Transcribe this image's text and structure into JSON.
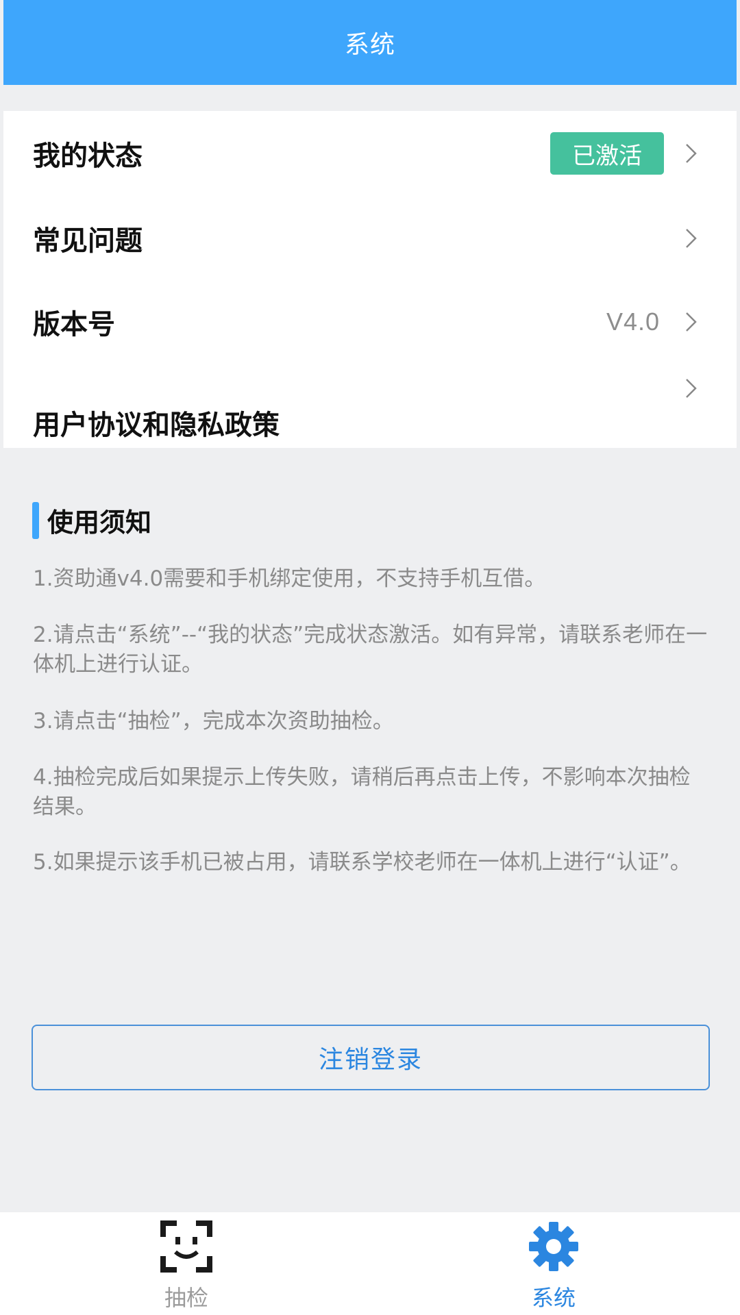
{
  "header": {
    "title": "系统"
  },
  "menu": {
    "status": {
      "label": "我的状态",
      "badge": "已激活"
    },
    "faq": {
      "label": "常见问题"
    },
    "version": {
      "label": "版本号",
      "value": "V4.0"
    },
    "agreement": {
      "label": "用户协议和隐私政策"
    }
  },
  "notice": {
    "title": "使用须知",
    "items": [
      "1.资助通v4.0需要和手机绑定使用，不支持手机互借。",
      "2.请点击“系统”--“我的状态”完成状态激活。如有异常，请联系老师在一体机上进行认证。",
      "3.请点击“抽检”，完成本次资助抽检。",
      "4.抽检完成后如果提示上传失败，请稍后再点击上传，不影响本次抽检结果。",
      "5.如果提示该手机已被占用，请联系学校老师在一体机上进行“认证”。"
    ]
  },
  "logout_label": "注销登录",
  "tabbar": {
    "tabs": [
      {
        "label": "抽检",
        "icon": "face-scan-icon",
        "active": false
      },
      {
        "label": "系统",
        "icon": "gear-icon",
        "active": true
      }
    ]
  },
  "colors": {
    "primary": "#3ea6fc",
    "badge": "#45c19d",
    "active_tab": "#2b86e0",
    "inactive_tab": "#9b9b9b"
  }
}
